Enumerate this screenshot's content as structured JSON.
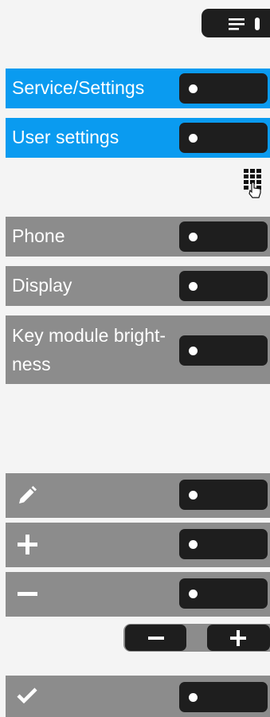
{
  "header": {
    "menu_icon": "menu-lines-icon"
  },
  "nav": [
    {
      "label": "Service/Settings"
    },
    {
      "label": "User settings"
    }
  ],
  "keypad_icon": "keypad-touch-icon",
  "menu_items": [
    {
      "label": "Phone"
    },
    {
      "label": "Display"
    },
    {
      "label": "Key module bright-\nness"
    }
  ],
  "action_items": [
    {
      "icon": "pencil-icon"
    },
    {
      "icon": "plus-icon"
    },
    {
      "icon": "minus-icon"
    }
  ],
  "rocker": {
    "minus_icon": "minus-icon",
    "plus_icon": "plus-icon"
  },
  "confirm": {
    "icon": "check-icon"
  },
  "colors": {
    "highlight": "#0a9bf0",
    "row": "#8c8c8c",
    "key": "#1e1e1e",
    "background": "#f4f4f4"
  }
}
